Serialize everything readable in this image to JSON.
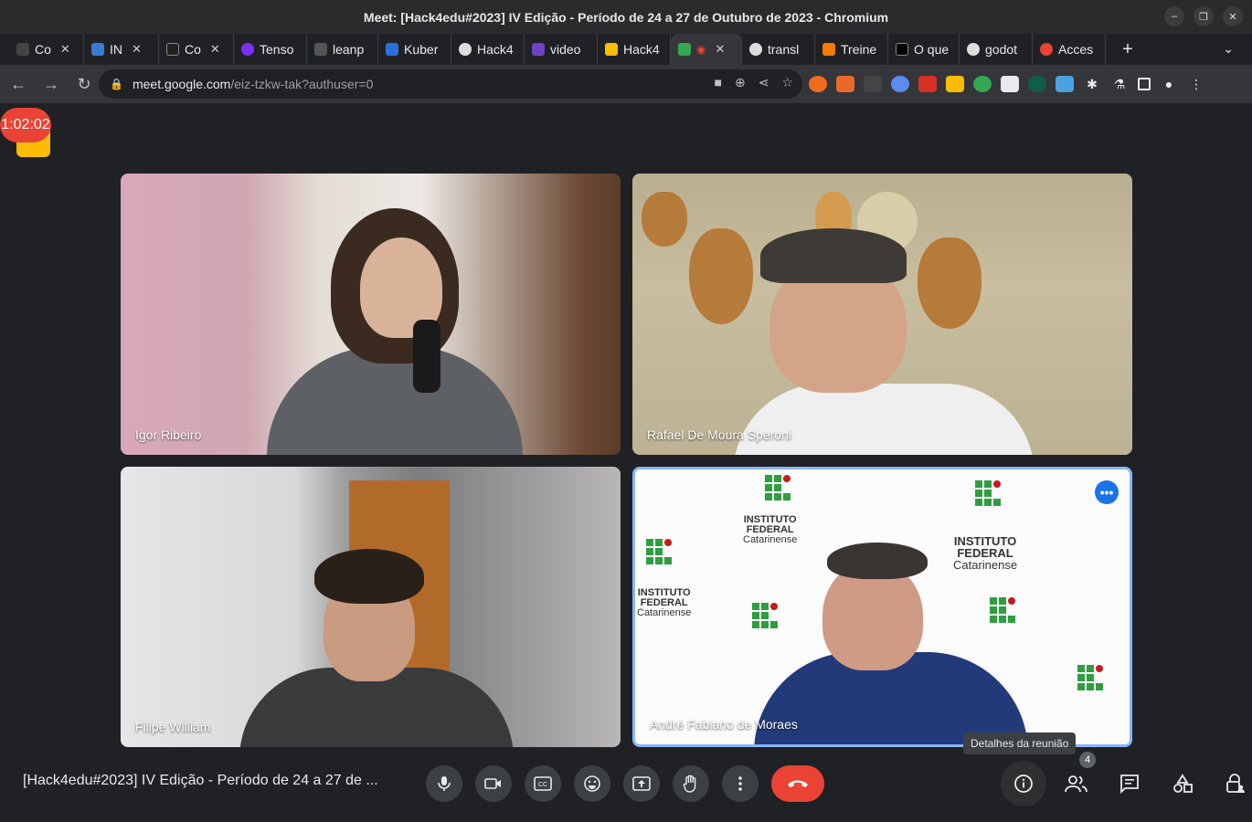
{
  "window": {
    "title": "Meet: [Hack4edu#2023] IV Edição - Período de 24 a 27 de Outubro de 2023 - Chromium"
  },
  "tabs": [
    {
      "label": "Co",
      "color": "#444"
    },
    {
      "label": "IN",
      "color": "#3a7bd5"
    },
    {
      "label": "Co",
      "color": "#222"
    },
    {
      "label": "Tenso",
      "color": "#7b2ff7"
    },
    {
      "label": "leanp",
      "color": "#555"
    },
    {
      "label": "Kuber",
      "color": "#2a6fdb"
    },
    {
      "label": "Hack4",
      "color": "#ddd"
    },
    {
      "label": "video",
      "color": "#6f42c1"
    },
    {
      "label": "Hack4",
      "color": "#fbbc04"
    },
    {
      "label": "",
      "color": "#34a853"
    },
    {
      "label": "transl",
      "color": "#ddd"
    },
    {
      "label": "Treine",
      "color": "#f57c00"
    },
    {
      "label": "O que",
      "color": "#000"
    },
    {
      "label": "godot",
      "color": "#ddd"
    },
    {
      "label": "Acces",
      "color": "#ea4335"
    }
  ],
  "address": {
    "host": "meet.google.com",
    "path": "/eiz-tzkw-tak?authuser=0"
  },
  "timer": "1:02:02",
  "participants": [
    {
      "name": "Igor Ribeiro"
    },
    {
      "name": "Rafael De Moura Speroni"
    },
    {
      "name": "Filipe William"
    },
    {
      "name": "André Fabiano de Moraes"
    }
  ],
  "logo": {
    "line1": "INSTITUTO",
    "line2": "FEDERAL",
    "line3": "Catarinense"
  },
  "tooltip": "Detalhes da reunião",
  "meeting_title": "[Hack4edu#2023] IV Edição - Período de 24 a 27 de ...",
  "people_count": "4"
}
